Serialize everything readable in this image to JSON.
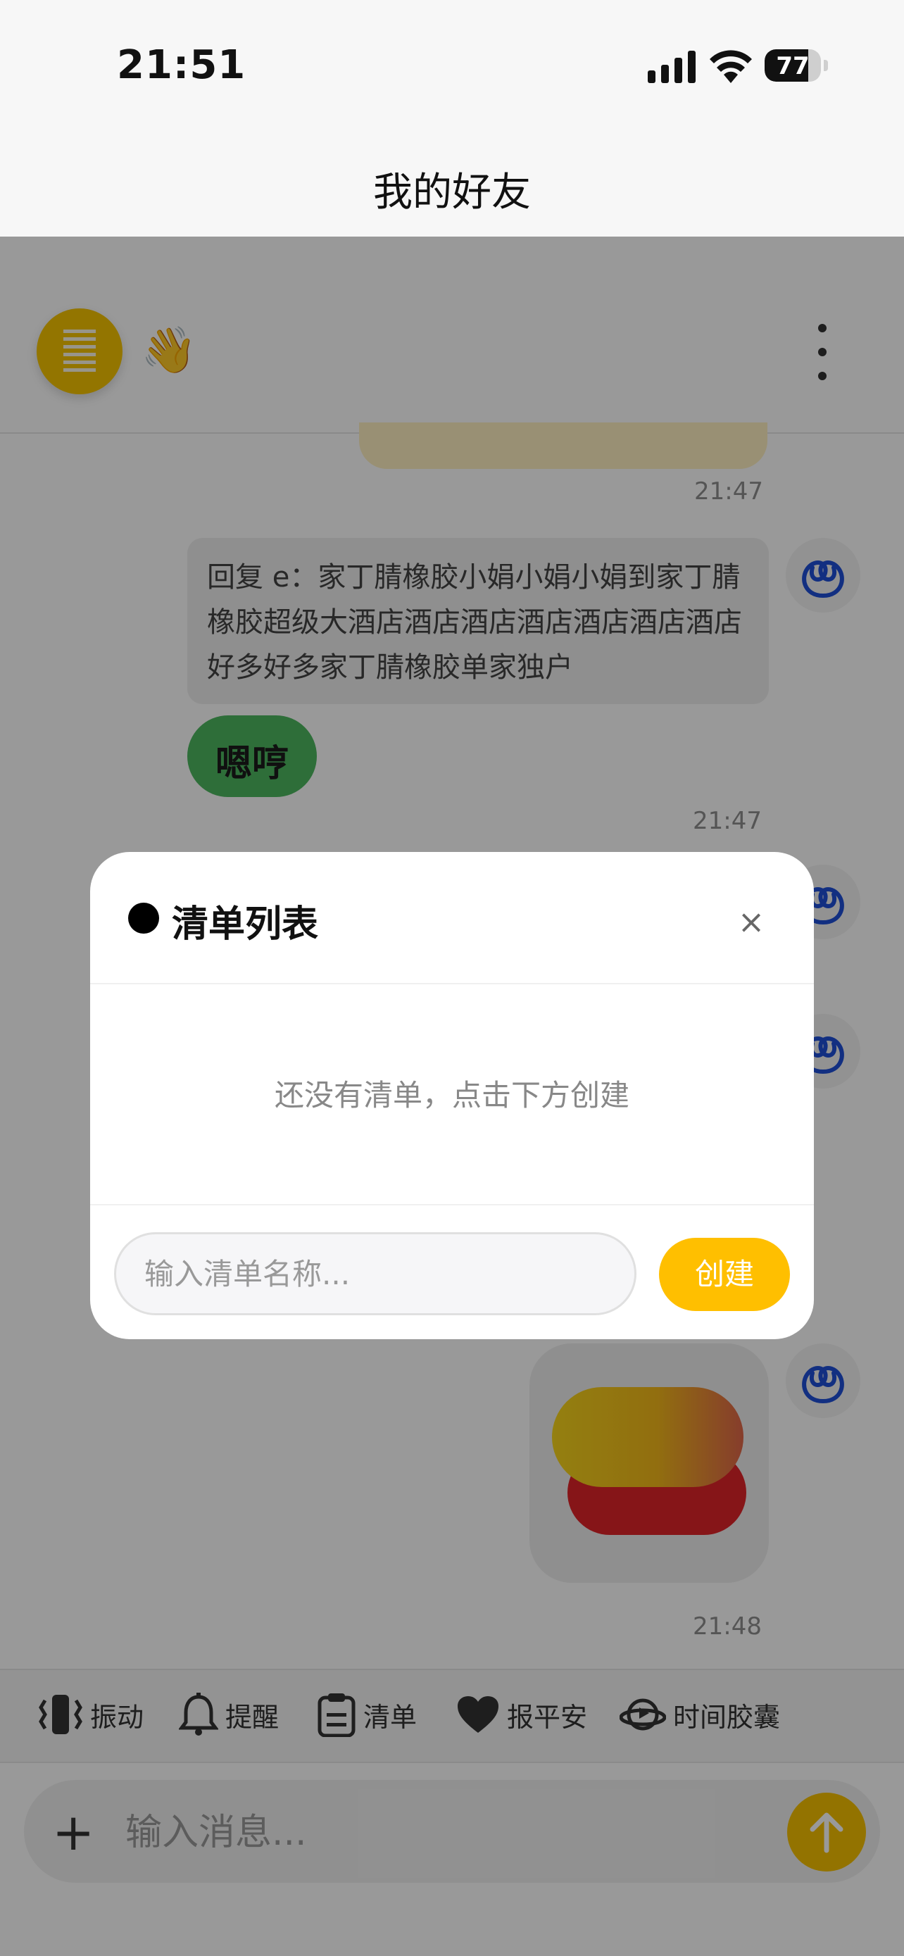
{
  "status_bar": {
    "time": "21:51",
    "battery": "77",
    "battery_level": 0.77
  },
  "nav": {
    "title": "我的好友"
  },
  "chat_header": {
    "wave_emoji": "👋"
  },
  "messages": {
    "ts1": "21:47",
    "reply_text": "回复 e：家丁腈橡胶小娟小娟小娟到家丁腈橡胶超级大酒店酒店酒店酒店酒店酒店酒店好多好多家丁腈橡胶单家独户",
    "green_text": "嗯哼",
    "ts2": "21:47",
    "ts3": "21:48"
  },
  "toolbar": {
    "items": [
      {
        "label": "振动",
        "icon": "vibrate-icon"
      },
      {
        "label": "提醒",
        "icon": "bell-icon"
      },
      {
        "label": "清单",
        "icon": "clipboard-icon"
      },
      {
        "label": "报平安",
        "icon": "heart-icon"
      },
      {
        "label": "时间胶囊",
        "icon": "capsule-icon"
      }
    ]
  },
  "composer": {
    "placeholder": "输入消息...",
    "plus": "+"
  },
  "modal": {
    "title": "清单列表",
    "close": "×",
    "empty_text": "还没有清单，点击下方创建",
    "input_placeholder": "输入清单名称...",
    "create_label": "创建"
  },
  "colors": {
    "accent": "#ffbf00",
    "green_bubble": "#4db860",
    "avatar_icon": "#1e4fd8"
  }
}
